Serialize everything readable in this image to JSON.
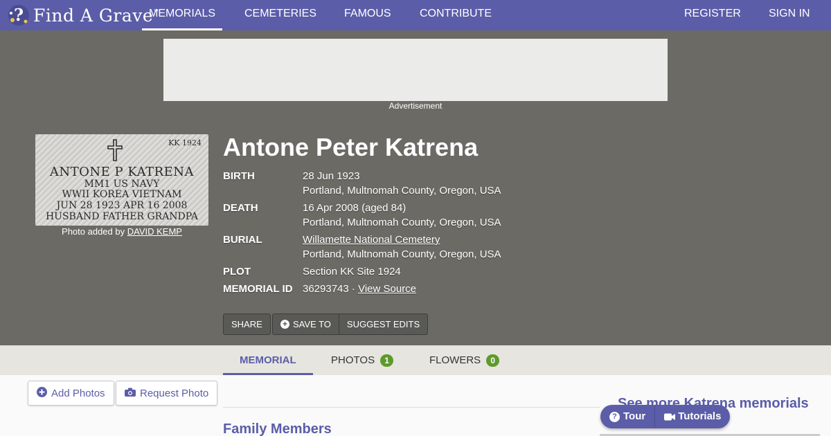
{
  "brand": {
    "name": "Find A Grave",
    "tm": "™"
  },
  "nav": {
    "memorials": "MEMORIALS",
    "cemeteries": "CEMETERIES",
    "famous": "FAMOUS",
    "contribute": "CONTRIBUTE",
    "register": "REGISTER",
    "signin": "SIGN IN"
  },
  "ad": {
    "label": "Advertisement"
  },
  "headstone": {
    "section": "KK 1924",
    "line1": "ANTONE P KATRENA",
    "line2": "MM1   US NAVY",
    "line3": "WWII   KOREA   VIETNAM",
    "line4": "JUN 28 1923      APR 16 2008",
    "line5": "HUSBAND FATHER GRANDPA"
  },
  "photo_credit": {
    "prefix": "Photo added by",
    "name": "DAVID KEMP"
  },
  "memorial": {
    "name": "Antone Peter Katrena",
    "birth_label": "BIRTH",
    "birth_date": "28 Jun 1923",
    "birth_place": "Portland, Multnomah County, Oregon, USA",
    "death_label": "DEATH",
    "death_date": "16 Apr 2008 (aged 84)",
    "death_place": "Portland, Multnomah County, Oregon, USA",
    "burial_label": "BURIAL",
    "burial_cemetery": "Willamette National Cemetery",
    "burial_place": "Portland, Multnomah County, Oregon, USA",
    "plot_label": "PLOT",
    "plot_value": "Section KK Site 1924",
    "id_label": "MEMORIAL ID",
    "id_value": "36293743",
    "id_sep": " · ",
    "view_source": "View Source"
  },
  "actions": {
    "share": "SHARE",
    "save_to": "SAVE TO",
    "suggest_edits": "SUGGEST EDITS"
  },
  "tabs": {
    "memorial": "MEMORIAL",
    "photos": "PHOTOS",
    "photos_count": "1",
    "flowers": "FLOWERS",
    "flowers_count": "0"
  },
  "lower": {
    "add_photos": "Add Photos",
    "request_photo": "Request Photo",
    "family_members": "Family Members",
    "see_more": "See more Katrena memorials"
  },
  "help": {
    "tour": "Tour",
    "tutorials": "Tutorials"
  },
  "colors": {
    "brand": "#5b5da8",
    "hero_bg": "#6b6a65",
    "badge": "#5e9a2b"
  }
}
